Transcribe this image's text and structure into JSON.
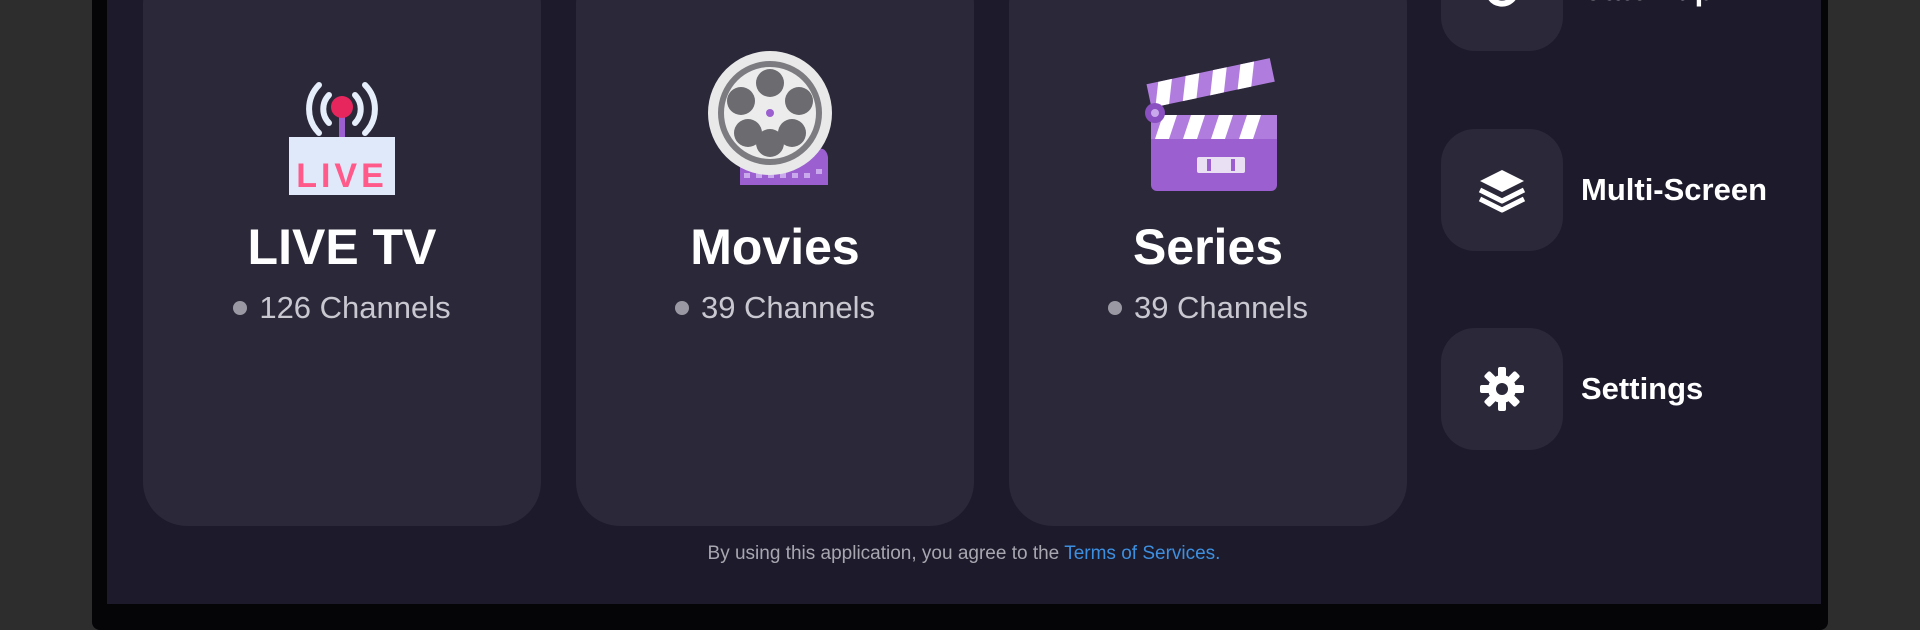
{
  "cards": [
    {
      "title": "LIVE TV",
      "count": "126 Channels",
      "icon": "live-tv-antenna-icon",
      "icon_text": "LIVE"
    },
    {
      "title": "Movies",
      "count": "39 Channels",
      "icon": "film-reel-icon"
    },
    {
      "title": "Series",
      "count": "39 Channels",
      "icon": "clapperboard-icon"
    }
  ],
  "sidebar": {
    "items": [
      {
        "label": "Catch up",
        "icon": "catch-up-icon"
      },
      {
        "label": "Multi-Screen",
        "icon": "layers-icon"
      },
      {
        "label": "Settings",
        "icon": "gear-icon"
      }
    ]
  },
  "footer": {
    "text": "By using this application, you agree to the",
    "link": "Terms of Services."
  },
  "colors": {
    "background": "#1c1a2b",
    "card": "#2b2939",
    "accent_purple": "#9b5fd0",
    "link": "#3d8fe0"
  }
}
